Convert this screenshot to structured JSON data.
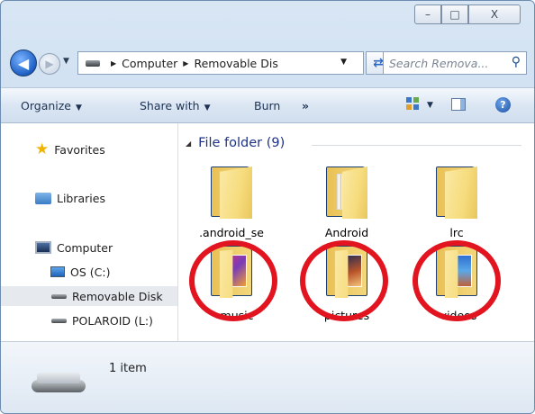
{
  "window": {
    "controls": {
      "minimize": "–",
      "maximize": "□",
      "close": "X"
    }
  },
  "nav": {
    "breadcrumbs": [
      "Computer",
      "Removable Dis"
    ],
    "search_placeholder": "Search Remova..."
  },
  "toolbar": {
    "organize": "Organize",
    "share_with": "Share with",
    "burn": "Burn",
    "more": "»"
  },
  "sidebar": {
    "favorites": "Favorites",
    "libraries": "Libraries",
    "computer": "Computer",
    "drives": [
      {
        "label": "OS (C:)"
      },
      {
        "label": "Removable Disk"
      },
      {
        "label": "POLAROID (L:)"
      }
    ]
  },
  "content": {
    "group_header": "File folder (9)",
    "folders": [
      {
        "name": ".android_se"
      },
      {
        "name": "Android"
      },
      {
        "name": "lrc"
      },
      {
        "name": "music"
      },
      {
        "name": "pictures"
      },
      {
        "name": "videos"
      }
    ]
  },
  "details": {
    "item_count": "1 item"
  },
  "colors": {
    "highlight_ring": "#e1141f",
    "header_text": "#1e3287",
    "selected_nav": "#e6e9ee"
  }
}
